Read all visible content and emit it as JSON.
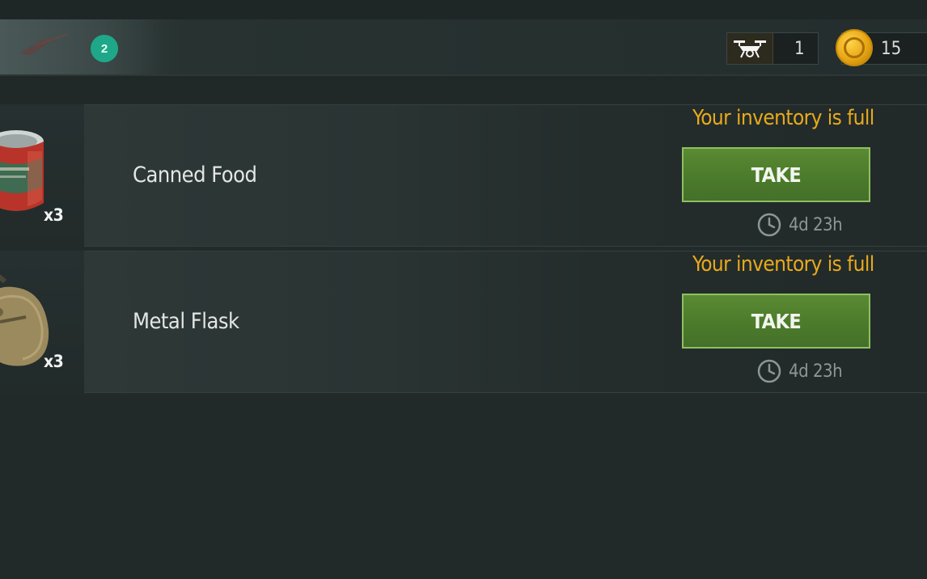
{
  "header": {
    "badge_count": "2",
    "currencies": [
      {
        "icon": "drone-icon",
        "value": "1"
      },
      {
        "icon": "coin-icon",
        "value": "15"
      }
    ]
  },
  "items": [
    {
      "name": "Canned Food",
      "quantity": "x3",
      "icon": "canned-food-icon",
      "warning": "Your inventory is full",
      "button_label": "TAKE",
      "timer_icon": "clock-icon",
      "time_left": "4d 23h"
    },
    {
      "name": "Metal Flask",
      "quantity": "x3",
      "icon": "metal-flask-icon",
      "warning": "Your inventory is full",
      "button_label": "TAKE",
      "timer_icon": "clock-icon",
      "time_left": "4d 23h"
    }
  ],
  "colors": {
    "background": "#222a29",
    "badge": "#1ea889",
    "warning": "#e8a91c",
    "button": "#4d7c2b",
    "button_border": "#8fbf62",
    "coin": "#e7a614"
  }
}
